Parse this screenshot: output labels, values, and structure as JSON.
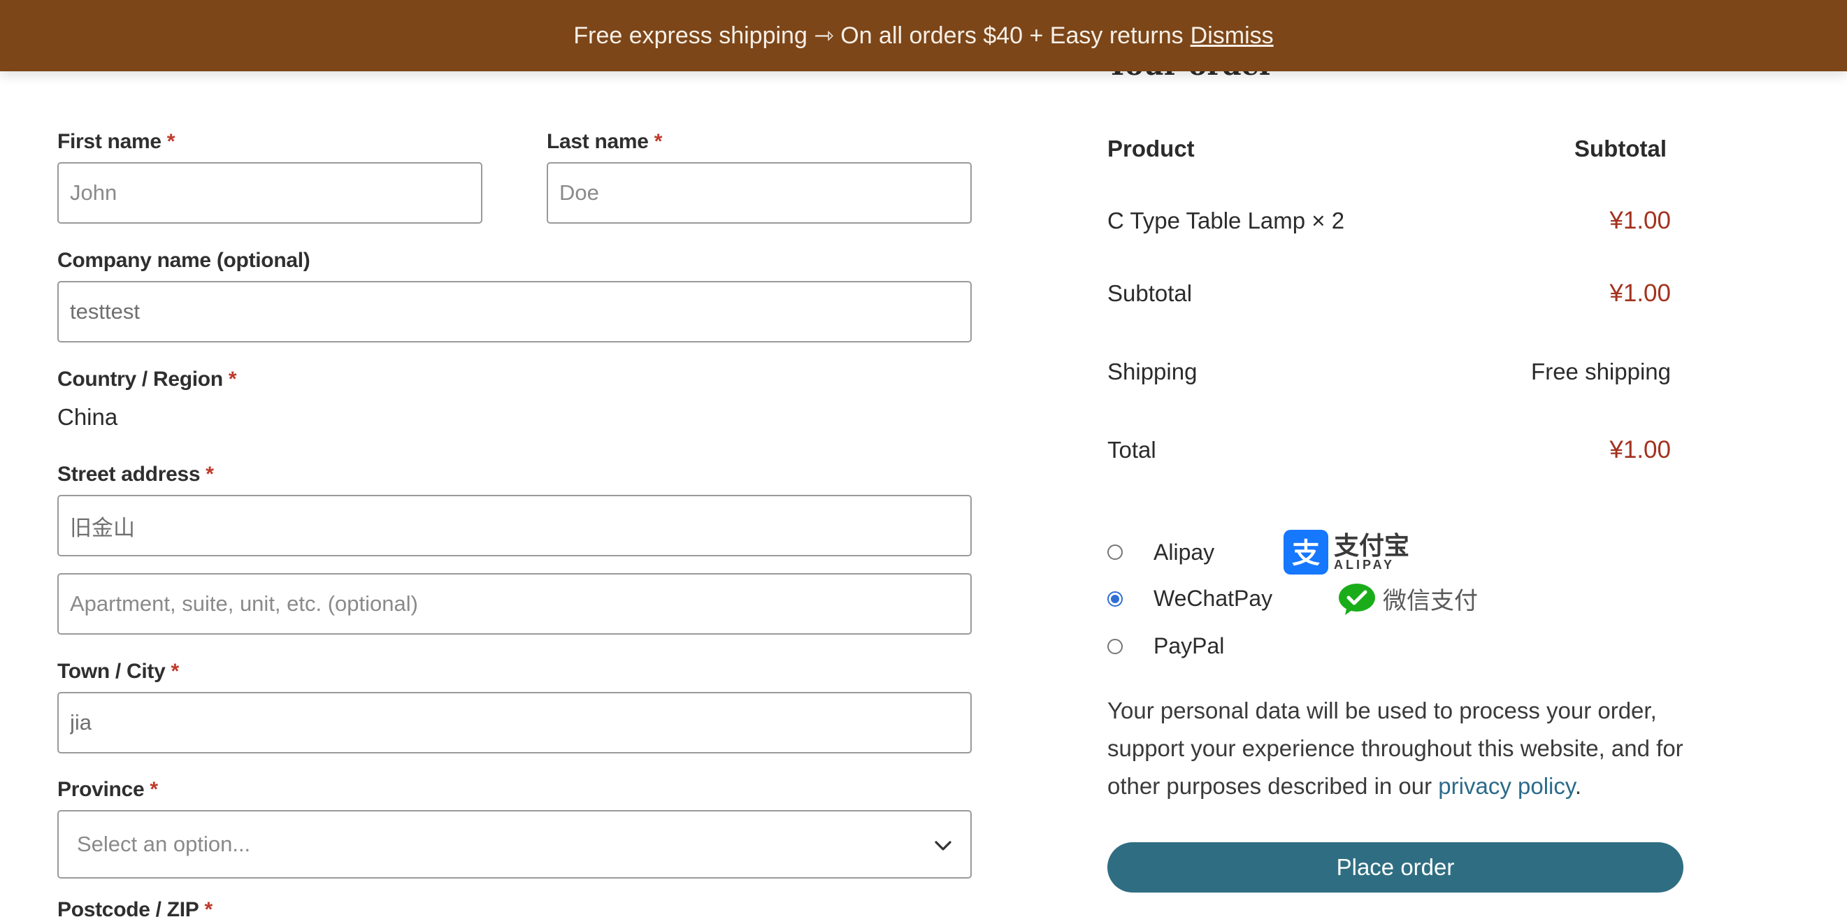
{
  "banner": {
    "text": "Free express shipping ⇾ On all orders $40 + Easy returns",
    "dismiss_label": "Dismiss"
  },
  "billing": {
    "first_name": {
      "label": "First name",
      "required_mark": "*",
      "placeholder": "John"
    },
    "last_name": {
      "label": "Last name",
      "required_mark": "*",
      "placeholder": "Doe"
    },
    "company": {
      "label": "Company name (optional)",
      "value": "testtest"
    },
    "country": {
      "label": "Country / Region",
      "required_mark": "*",
      "value": "China"
    },
    "street": {
      "label": "Street address",
      "required_mark": "*",
      "value": "旧金山",
      "placeholder2": "Apartment, suite, unit, etc. (optional)"
    },
    "city": {
      "label": "Town / City",
      "required_mark": "*",
      "value": "jia"
    },
    "province": {
      "label": "Province",
      "required_mark": "*",
      "placeholder": "Select an option..."
    },
    "postcode": {
      "label": "Postcode / ZIP",
      "required_mark": "*"
    }
  },
  "order": {
    "heading": "Your order",
    "col_product": "Product",
    "col_subtotal": "Subtotal",
    "item": {
      "name": "C Type Table Lamp × 2",
      "price": "¥1.00"
    },
    "subtotal": {
      "label": "Subtotal",
      "value": "¥1.00"
    },
    "shipping": {
      "label": "Shipping",
      "value": "Free shipping"
    },
    "total": {
      "label": "Total",
      "value": "¥1.00"
    }
  },
  "payment": {
    "methods": [
      {
        "label": "Alipay",
        "logo_text": "支付宝",
        "logo_sub": "ALIPAY",
        "selected": false
      },
      {
        "label": "WeChatPay",
        "logo_text": "微信支付",
        "selected": true
      },
      {
        "label": "PayPal",
        "selected": false
      }
    ],
    "colors": {
      "alipay": "#1677ff",
      "wechat": "#1aad19"
    }
  },
  "privacy": {
    "text": "Your personal data will be used to process your order, support your experience throughout this website, and for other purposes described in our",
    "link": "privacy policy",
    "end": "."
  },
  "place_order_label": "Place order",
  "colors": {
    "banner": "#7c4619",
    "button": "#2f6e82",
    "price": "#a3321f",
    "required": "#c0392b"
  }
}
